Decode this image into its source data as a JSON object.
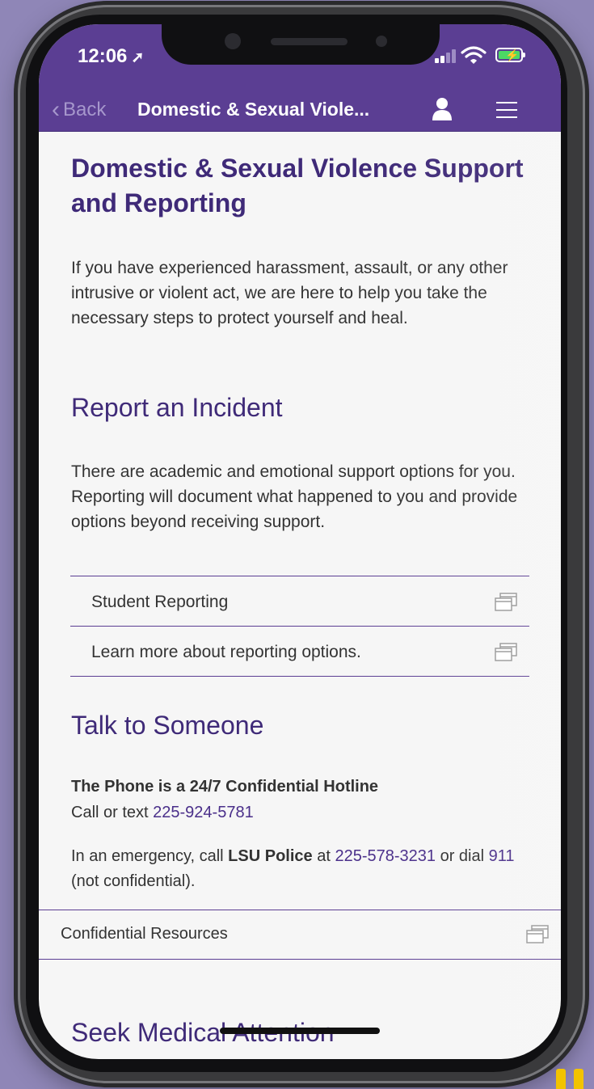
{
  "status_bar": {
    "time": "12:06"
  },
  "nav": {
    "back_label": "Back",
    "title": "Domestic & Sexual Viole..."
  },
  "page": {
    "title": "Domestic & Sexual Violence Support and Reporting",
    "intro": "If you have experienced harassment, assault, or any other intrusive or violent act, we are here to help you take the necessary steps to protect yourself and heal."
  },
  "report": {
    "heading": "Report an Incident",
    "text": "There are academic and emotional support options for you. Reporting will document what happened to you and provide options beyond receiving support.",
    "links": [
      {
        "label": "Student Reporting"
      },
      {
        "label": "Learn more about reporting options."
      }
    ]
  },
  "talk": {
    "heading": "Talk to Someone",
    "hotline_title": "The Phone is a 24/7 Confidential Hotline",
    "hotline_prefix": "Call or text ",
    "hotline_number": "225-924-5781",
    "emergency_prefix": "In an emergency, call ",
    "emergency_agency": "LSU Police",
    "emergency_mid": " at ",
    "emergency_number": "225-578-3231",
    "emergency_pre911": " or dial ",
    "emergency_911": "911",
    "emergency_suffix": " (not confidential).",
    "confidential_link": "Confidential Resources"
  },
  "medical": {
    "heading": "Seek Medical Attention"
  },
  "colors": {
    "brand_purple": "#5b3e93",
    "heading_purple": "#3f2a78",
    "link_purple": "#4a2f8a",
    "background": "#8f86b7"
  },
  "icons": [
    "location-arrow-icon",
    "signal-icon",
    "wifi-icon",
    "battery-charging-icon",
    "chevron-left-icon",
    "user-icon",
    "menu-icon",
    "external-window-icon"
  ]
}
